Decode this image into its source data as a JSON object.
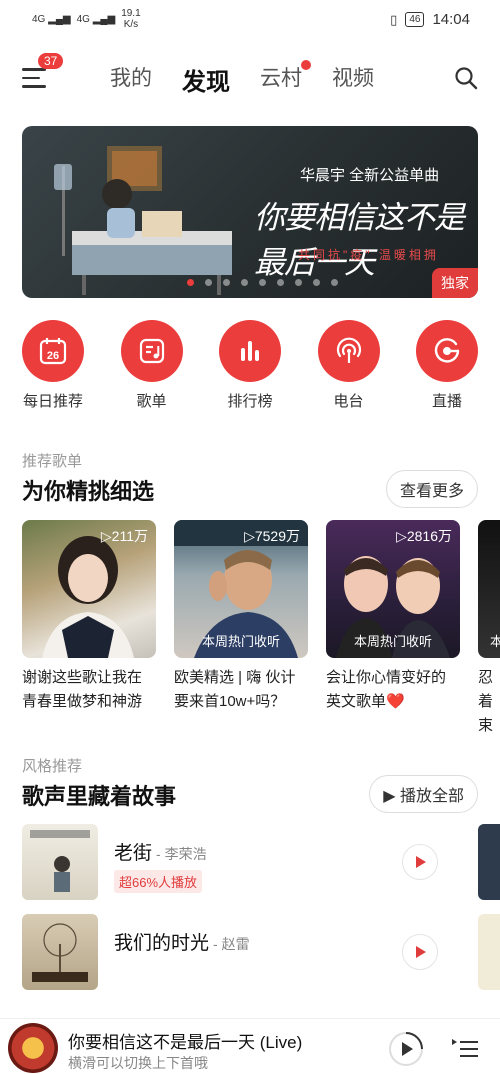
{
  "status_bar": {
    "signal1": "4G",
    "signal2": "4G",
    "speed": "19.1",
    "speed_unit": "K/s",
    "battery": "46",
    "time": "14:04"
  },
  "header": {
    "badge": "37",
    "tabs": [
      {
        "label": "我的"
      },
      {
        "label": "发现"
      },
      {
        "label": "云村"
      },
      {
        "label": "视频"
      }
    ]
  },
  "banner": {
    "artist_line": "华晨宇 全新公益单曲",
    "song_title": "你要相信这不是最后一天",
    "subtitle": "共同抗\"疫\" 温暖相拥",
    "tag": "独家",
    "slide_count": 9,
    "active_slide": 0
  },
  "quick_entries": [
    {
      "label": "每日推荐",
      "icon": "calendar-icon",
      "day": "26"
    },
    {
      "label": "歌单",
      "icon": "playlist-icon"
    },
    {
      "label": "排行榜",
      "icon": "chart-bars-icon"
    },
    {
      "label": "电台",
      "icon": "radio-icon"
    },
    {
      "label": "直播",
      "icon": "live-icon"
    }
  ],
  "recommend": {
    "kicker": "推荐歌单",
    "title": "为你精挑细选",
    "more_button": "查看更多",
    "cards": [
      {
        "plays": "211万",
        "hot": "",
        "title": "谢谢这些歌让我在青春里做梦和神游"
      },
      {
        "plays": "7529万",
        "hot": "本周热门收听",
        "title": "欧美精选 | 嗨 伙计要来首10w+吗？"
      },
      {
        "plays": "2816万",
        "hot": "本周热门收听",
        "title": "会让你心情变好的英文歌单❤️"
      },
      {
        "plays": "",
        "hot": "本",
        "title": "忍着束"
      }
    ]
  },
  "style": {
    "kicker": "风格推荐",
    "title": "歌声里藏着故事",
    "play_all": "播放全部",
    "songs": [
      {
        "name": "老街",
        "artist": "- 李荣浩",
        "tag": "超66%人播放"
      },
      {
        "name": "我们的时光",
        "artist": "- 赵雷",
        "tag": ""
      }
    ]
  },
  "player": {
    "song": "你要相信这不是最后一天 (Live)",
    "hint": "横滑可以切换上下首哦"
  },
  "colors": {
    "accent": "#ec3d3d"
  }
}
